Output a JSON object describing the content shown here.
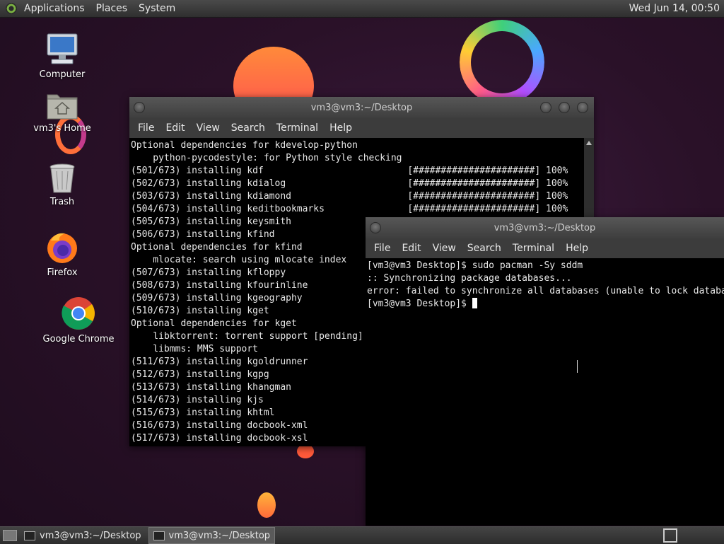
{
  "top_panel": {
    "menus": [
      "Applications",
      "Places",
      "System"
    ],
    "clock": "Wed Jun 14, 00:50"
  },
  "desktop_icons": [
    {
      "label": "Computer"
    },
    {
      "label": "vm3's Home"
    },
    {
      "label": "Trash"
    },
    {
      "label": "Firefox"
    },
    {
      "label": "Google Chrome"
    }
  ],
  "window_1": {
    "title": "vm3@vm3:~/Desktop",
    "menu": [
      "File",
      "Edit",
      "View",
      "Search",
      "Terminal",
      "Help"
    ],
    "lines": [
      "Optional dependencies for kdevelop-python",
      "    python-pycodestyle: for Python style checking",
      "(501/673) installing kdf                          [######################] 100%",
      "(502/673) installing kdialog                      [######################] 100%",
      "(503/673) installing kdiamond                     [######################] 100%",
      "(504/673) installing keditbookmarks               [######################] 100%",
      "(505/673) installing keysmith",
      "(506/673) installing kfind",
      "Optional dependencies for kfind",
      "    mlocate: search using mlocate index",
      "(507/673) installing kfloppy",
      "(508/673) installing kfourinline",
      "(509/673) installing kgeography",
      "(510/673) installing kget",
      "Optional dependencies for kget",
      "    libktorrent: torrent support [pending]",
      "    libmms: MMS support",
      "(511/673) installing kgoldrunner",
      "(512/673) installing kgpg",
      "(513/673) installing khangman",
      "(514/673) installing kjs",
      "(515/673) installing khtml",
      "(516/673) installing docbook-xml",
      "(517/673) installing docbook-xsl"
    ]
  },
  "window_2": {
    "title": "vm3@vm3:~/Desktop",
    "menu": [
      "File",
      "Edit",
      "View",
      "Search",
      "Terminal",
      "Help"
    ],
    "lines": [
      "[vm3@vm3 Desktop]$ sudo pacman -Sy sddm",
      ":: Synchronizing package databases...",
      "error: failed to synchronize all databases (unable to lock database)"
    ],
    "prompt": "[vm3@vm3 Desktop]$ "
  },
  "taskbar": {
    "tasks": [
      {
        "label": "vm3@vm3:~/Desktop",
        "active": false
      },
      {
        "label": "vm3@vm3:~/Desktop",
        "active": true
      }
    ]
  }
}
